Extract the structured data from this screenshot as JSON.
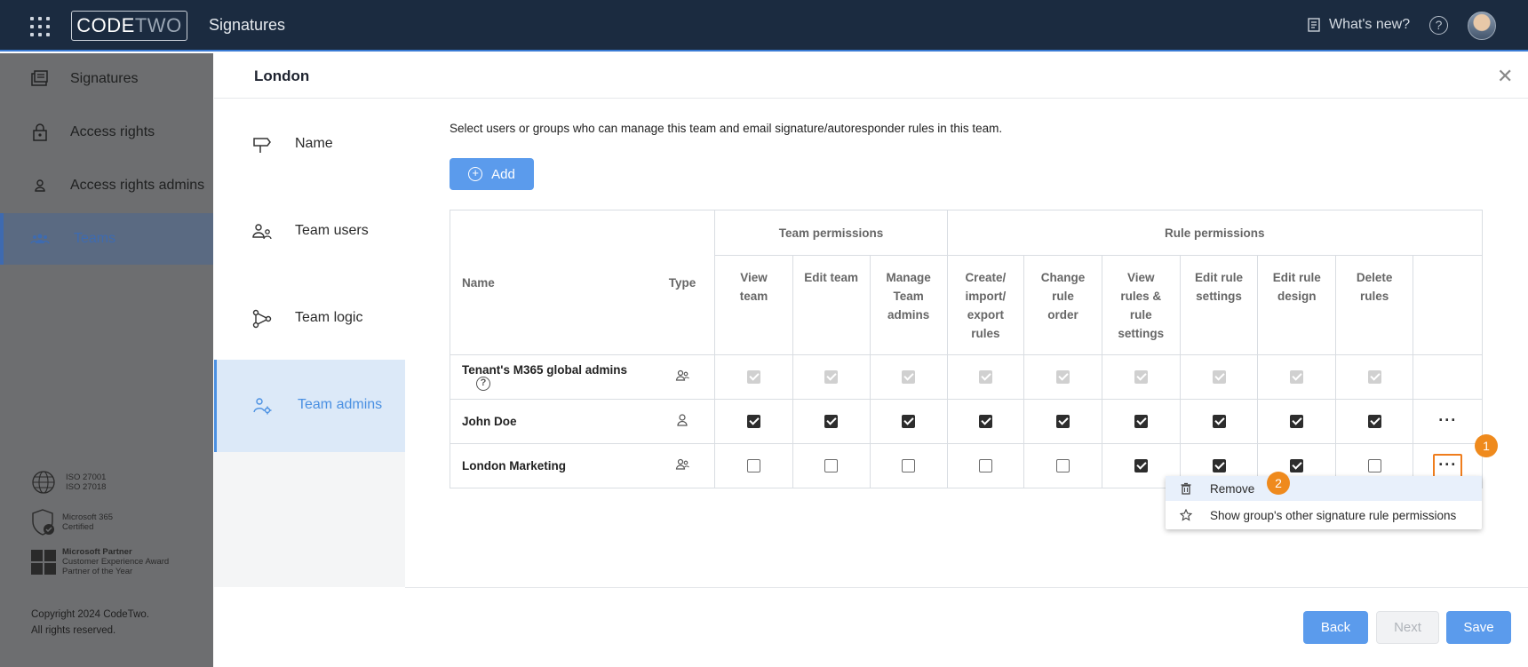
{
  "topbar": {
    "logo_part1": "CODE",
    "logo_part2": "TWO",
    "app_name": "Signatures",
    "whats_new": "What's new?",
    "help": "?"
  },
  "leftnav": {
    "items": [
      {
        "label": "Signatures"
      },
      {
        "label": "Access rights"
      },
      {
        "label": "Access rights admins"
      },
      {
        "label": "Teams"
      }
    ],
    "badges": [
      {
        "line1": "ISO 27001",
        "line2": "ISO 27018",
        "line3": ""
      },
      {
        "line1": "Microsoft 365",
        "line2": "Certified",
        "line3": ""
      },
      {
        "line1": "Microsoft Partner",
        "line2": "Customer Experience Award",
        "line3": "Partner of the Year"
      }
    ],
    "copyright_line1": "Copyright 2024 CodeTwo.",
    "copyright_line2": "All rights reserved."
  },
  "dialog": {
    "title": "London",
    "close": "✕",
    "steps": [
      {
        "label": "Name"
      },
      {
        "label": "Team users"
      },
      {
        "label": "Team logic"
      },
      {
        "label": "Team admins"
      }
    ],
    "intro": "Select users or groups who can manage this team and email signature/autoresponder rules in this team.",
    "add_label": "Add"
  },
  "table": {
    "group_headers": {
      "team": "Team permissions",
      "rule": "Rule permissions"
    },
    "name_header": "Name",
    "type_header": "Type",
    "columns": [
      [
        "View",
        "team"
      ],
      [
        "Edit team"
      ],
      [
        "Manage",
        "Team",
        "admins"
      ],
      [
        "Create/",
        "import/",
        "export",
        "rules"
      ],
      [
        "Change",
        "rule",
        "order"
      ],
      [
        "View",
        "rules &",
        "rule",
        "settings"
      ],
      [
        "Edit rule",
        "settings"
      ],
      [
        "Edit rule",
        "design"
      ],
      [
        "Delete",
        "rules"
      ]
    ],
    "rows": [
      {
        "name": "Tenant's M365 global admins",
        "type": "group",
        "help": "?",
        "checks": [
          "disabled",
          "disabled",
          "disabled",
          "disabled",
          "disabled",
          "disabled",
          "disabled",
          "disabled",
          "disabled"
        ],
        "more": ""
      },
      {
        "name": "John Doe",
        "type": "user",
        "help": "",
        "checks": [
          "on",
          "on",
          "on",
          "on",
          "on",
          "on",
          "on",
          "on",
          "on"
        ],
        "more": "···"
      },
      {
        "name": "London Marketing",
        "type": "group",
        "help": "",
        "checks": [
          "off",
          "off",
          "off",
          "off",
          "off",
          "on",
          "on",
          "on",
          "off"
        ],
        "more": "···"
      }
    ]
  },
  "context_menu": {
    "items": [
      {
        "label": "Remove"
      },
      {
        "label": "Show group's other signature rule permissions"
      }
    ]
  },
  "markers": {
    "first": "1",
    "second": "2"
  },
  "footer": {
    "back": "Back",
    "next": "Next",
    "save": "Save"
  },
  "colors": {
    "accent": "#5b9bec",
    "highlight": "#ef7d1d",
    "topbar": "#1b2b40"
  }
}
